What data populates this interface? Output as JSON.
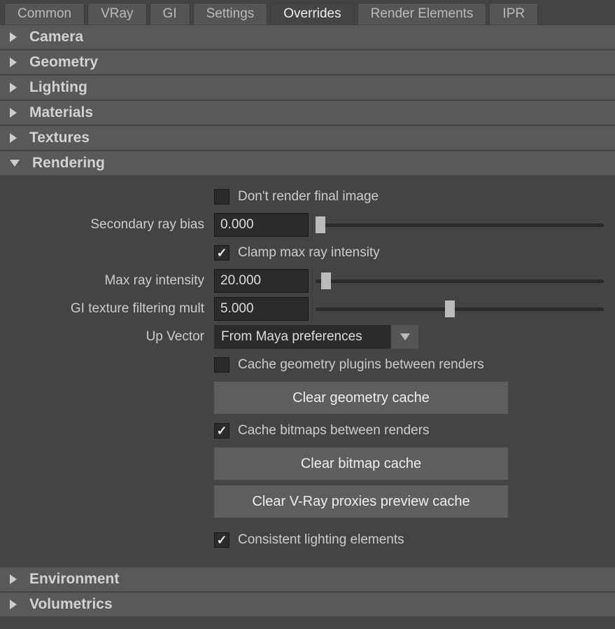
{
  "tabs": [
    "Common",
    "VRay",
    "GI",
    "Settings",
    "Overrides",
    "Render Elements",
    "IPR"
  ],
  "active_tab": "Overrides",
  "sections": {
    "camera": "Camera",
    "geometry": "Geometry",
    "lighting": "Lighting",
    "materials": "Materials",
    "textures": "Textures",
    "rendering": "Rendering",
    "environment": "Environment",
    "volumetrics": "Volumetrics"
  },
  "rendering": {
    "dont_render_label": "Don't render final image",
    "dont_render_checked": false,
    "secondary_ray_bias_label": "Secondary ray bias",
    "secondary_ray_bias_value": "0.000",
    "secondary_ray_bias_slider_pct": 0,
    "clamp_label": "Clamp max ray intensity",
    "clamp_checked": true,
    "max_ray_intensity_label": "Max ray intensity",
    "max_ray_intensity_value": "20.000",
    "max_ray_intensity_slider_pct": 2,
    "gi_texture_label": "GI texture filtering mult",
    "gi_texture_value": "5.000",
    "gi_texture_slider_pct": 45,
    "up_vector_label": "Up Vector",
    "up_vector_value": "From Maya preferences",
    "cache_geom_label": "Cache geometry plugins between renders",
    "cache_geom_checked": false,
    "clear_geom_btn": "Clear geometry cache",
    "cache_bitmaps_label": "Cache bitmaps between renders",
    "cache_bitmaps_checked": true,
    "clear_bitmap_btn": "Clear bitmap cache",
    "clear_proxies_btn": "Clear V-Ray proxies preview cache",
    "consistent_lighting_label": "Consistent lighting elements",
    "consistent_lighting_checked": true
  }
}
